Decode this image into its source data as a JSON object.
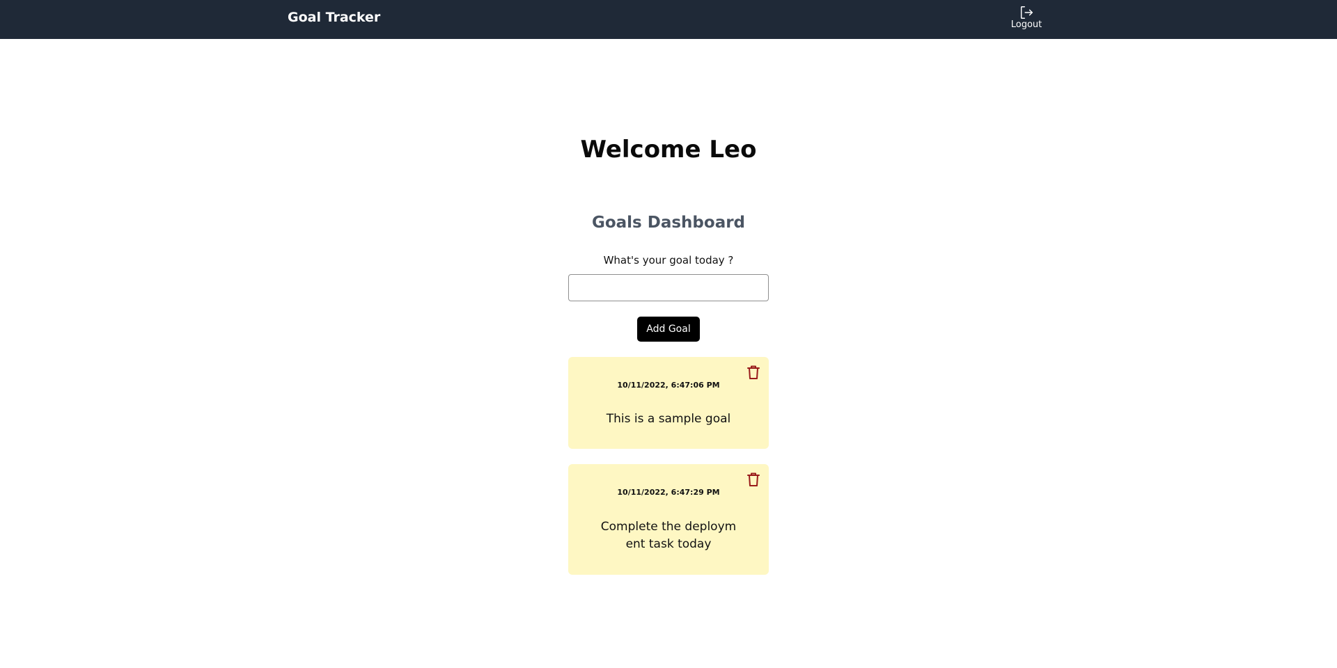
{
  "header": {
    "title": "Goal Tracker",
    "logout_label": "Logout",
    "background": "#1f2937"
  },
  "main": {
    "welcome": "Welcome Leo",
    "dashboard_title": "Goals Dashboard",
    "goal_prompt": "What's your goal today ?",
    "goal_input_value": "",
    "add_button_label": "Add Goal"
  },
  "goals": [
    {
      "timestamp": "10/11/2022, 6:47:06 PM",
      "text": "This is a sample goal",
      "delete_icon": "trash-icon"
    },
    {
      "timestamp": "10/11/2022, 6:47:29 PM",
      "text": "Complete the deployment task today",
      "delete_icon": "trash-icon"
    }
  ],
  "colors": {
    "card_background": "#fef7c3",
    "delete_icon": "#991b1b",
    "button": "#000000"
  }
}
